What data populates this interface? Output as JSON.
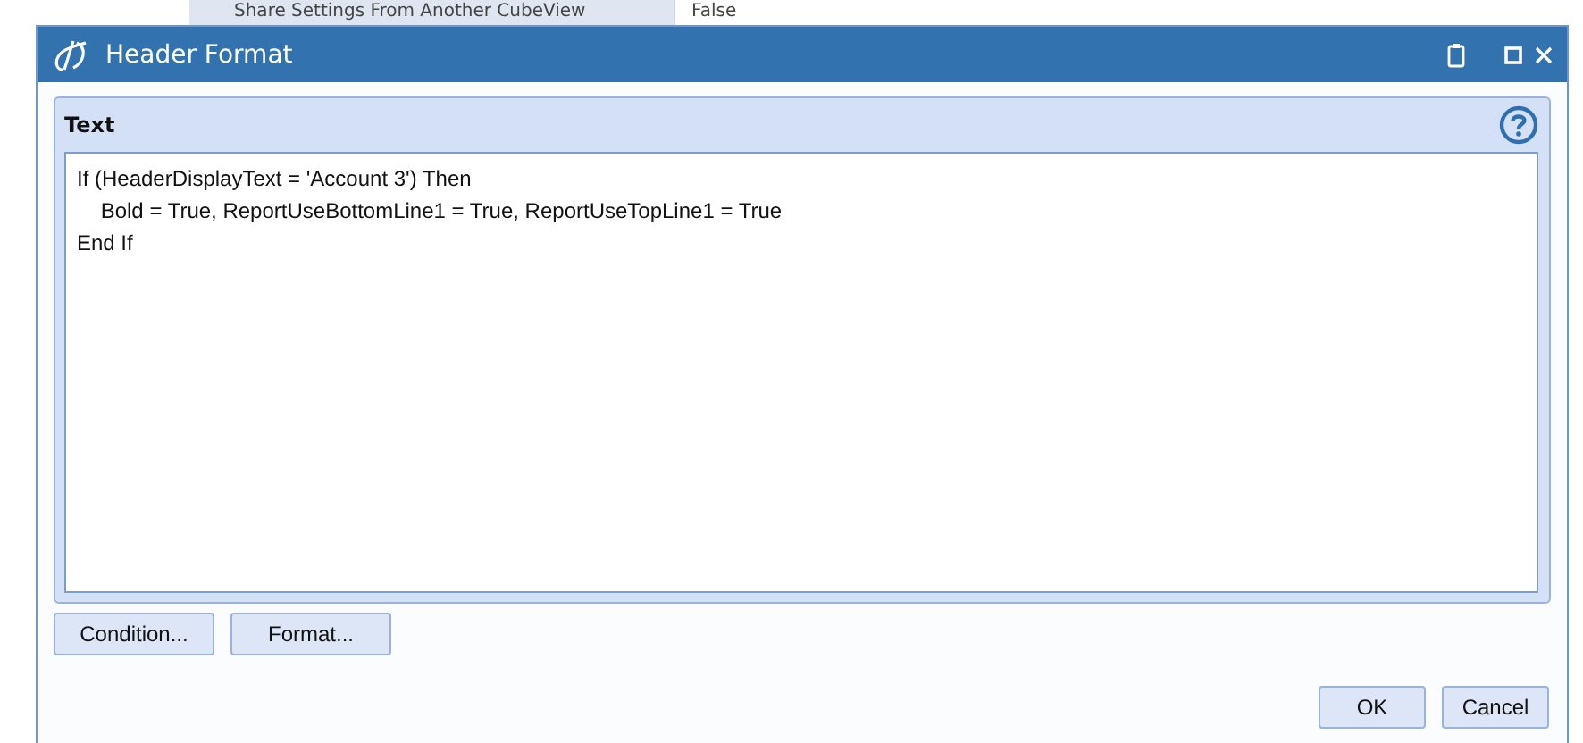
{
  "background_row": {
    "label": "Share Settings From Another CubeView",
    "value": "False"
  },
  "window": {
    "title": "Header Format"
  },
  "panel": {
    "title": "Text",
    "lines": [
      "If (HeaderDisplayText = 'Account 3') Then",
      "    Bold = True, ReportUseBottomLine1 = True, ReportUseTopLine1 = True",
      "End If"
    ]
  },
  "action_buttons": [
    "Condition...",
    "Format..."
  ],
  "buttons": [
    "OK",
    "Cancel"
  ]
}
